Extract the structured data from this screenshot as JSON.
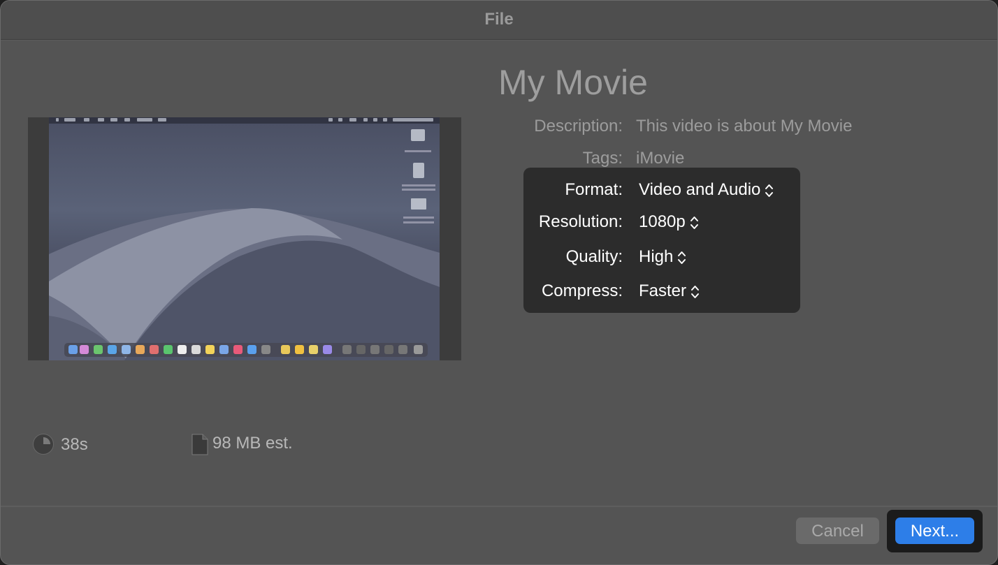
{
  "window": {
    "title": "File"
  },
  "project": {
    "title": "My Movie"
  },
  "info": {
    "description_label": "Description:",
    "description_value": "This video is about My Movie",
    "tags_label": "Tags:",
    "tags_value": "iMovie"
  },
  "options": {
    "format_label": "Format:",
    "format_value": "Video and Audio",
    "resolution_label": "Resolution:",
    "resolution_value": "1080p",
    "quality_label": "Quality:",
    "quality_value": "High",
    "compress_label": "Compress:",
    "compress_value": "Faster"
  },
  "stats": {
    "duration": "38s",
    "size": "98 MB est.",
    "duration_icon": "clock-icon",
    "size_icon": "document-icon"
  },
  "buttons": {
    "cancel_label": "Cancel",
    "next_label": "Next..."
  },
  "colors": {
    "accent": "#2d7ee8",
    "panel": "#2c2c2c",
    "window": "#545454"
  }
}
